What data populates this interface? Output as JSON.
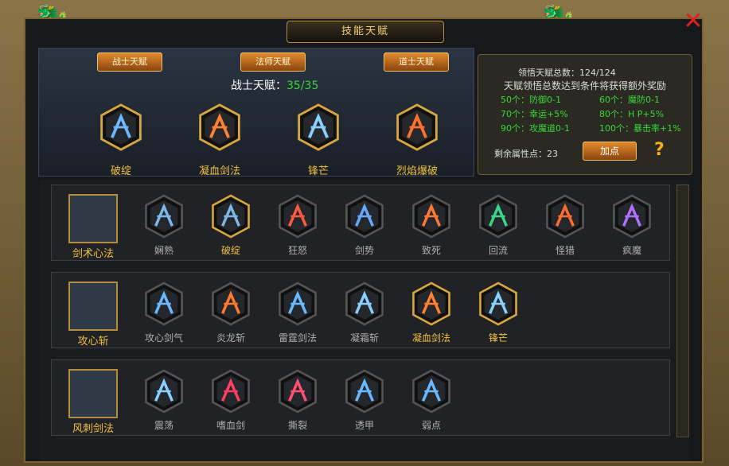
{
  "window": {
    "title": "技能天赋",
    "close": "✕"
  },
  "tabs": [
    {
      "label": "战士天赋"
    },
    {
      "label": "法师天赋"
    },
    {
      "label": "道士天赋"
    }
  ],
  "points": {
    "label": "战士天赋：",
    "value": "35/35"
  },
  "equipped": [
    {
      "name": "破绽",
      "icon": "sword-light-icon",
      "color": "#6fb8ff"
    },
    {
      "name": "凝血剑法",
      "icon": "fire-blades-icon",
      "color": "#ff8030"
    },
    {
      "name": "锋芒",
      "icon": "ice-burst-icon",
      "color": "#8ad0ff"
    },
    {
      "name": "烈焰爆破",
      "icon": "flame-blast-icon",
      "color": "#ff7030"
    }
  ],
  "info": {
    "total_label": "领悟天赋总数：",
    "total_value": "124/124",
    "desc": "天赋领悟总数达到条件将获得额外奖励",
    "rewards": [
      {
        "req": "50个：",
        "text": "防御0-1"
      },
      {
        "req": "60个：",
        "text": "魔防0-1"
      },
      {
        "req": "70个：",
        "text": "幸运+5%"
      },
      {
        "req": "80个：",
        "text": "H  P+5%"
      },
      {
        "req": "90个：",
        "text": "攻魔道0-1"
      },
      {
        "req": "100个：",
        "text": "暴击率+1%"
      }
    ],
    "remaining_label": "剩余属性点：",
    "remaining_value": "23",
    "add_button": "加点",
    "help": "?"
  },
  "categories": [
    {
      "name": "剑术心法",
      "icon": "sword-icon",
      "skills": [
        {
          "name": "娴熟",
          "on": false,
          "color": "#7fb8e8"
        },
        {
          "name": "破绽",
          "on": true,
          "color": "#7fb8e8"
        },
        {
          "name": "狂怒",
          "on": false,
          "color": "#ff5a40"
        },
        {
          "name": "剑势",
          "on": false,
          "color": "#6aa8ff"
        },
        {
          "name": "致死",
          "on": false,
          "color": "#ff7a30"
        },
        {
          "name": "回流",
          "on": false,
          "color": "#3ad68a"
        },
        {
          "name": "怪猎",
          "on": false,
          "color": "#ff6a30"
        },
        {
          "name": "疯魔",
          "on": false,
          "color": "#b070ff"
        }
      ]
    },
    {
      "name": "攻心斩",
      "icon": "ice-slash-icon",
      "skills": [
        {
          "name": "攻心剑气",
          "on": false,
          "color": "#6ab8ff"
        },
        {
          "name": "炎龙斩",
          "on": false,
          "color": "#ff7a30"
        },
        {
          "name": "雷霆剑法",
          "on": false,
          "color": "#6ab8ff"
        },
        {
          "name": "凝霜斩",
          "on": false,
          "color": "#8ad0ff"
        },
        {
          "name": "凝血剑法",
          "on": true,
          "color": "#ff8030"
        },
        {
          "name": "锋芒",
          "on": true,
          "color": "#8ad0ff"
        }
      ]
    },
    {
      "name": "风刺剑法",
      "icon": "crescent-icon",
      "skills": [
        {
          "name": "震荡",
          "on": false,
          "color": "#8ad0ff"
        },
        {
          "name": "嗜血剑",
          "on": false,
          "color": "#ff4060"
        },
        {
          "name": "撕裂",
          "on": false,
          "color": "#ff5070"
        },
        {
          "name": "透甲",
          "on": false,
          "color": "#6ab8ff"
        },
        {
          "name": "弱点",
          "on": false,
          "color": "#6ab8ff"
        }
      ]
    }
  ]
}
